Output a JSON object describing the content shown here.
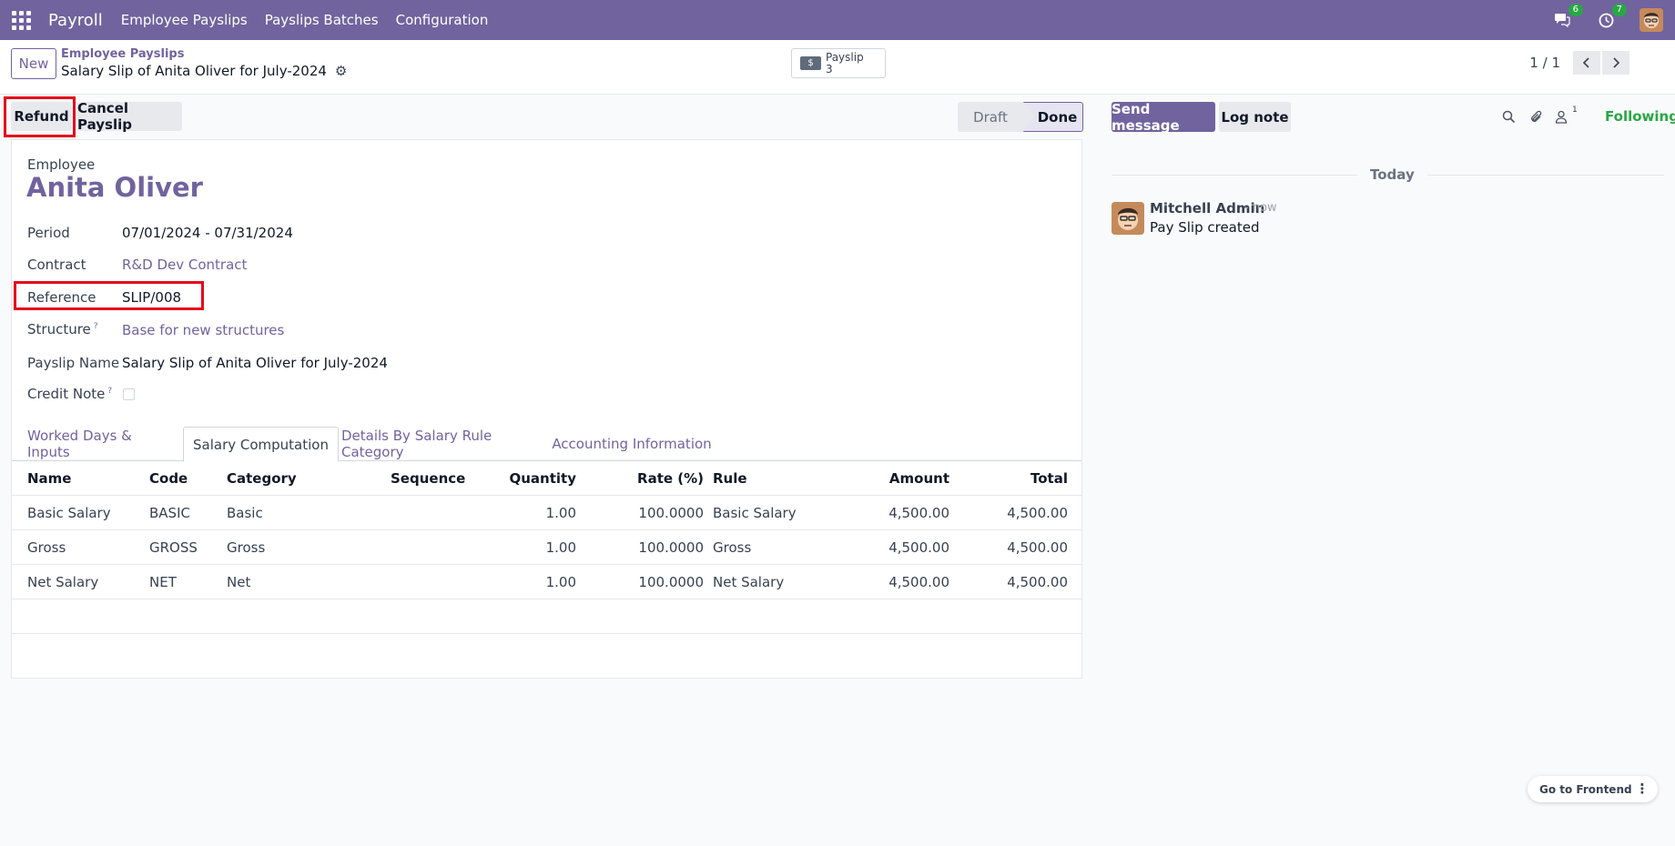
{
  "navbar": {
    "brand": "Payroll",
    "items": [
      "Employee Payslips",
      "Payslips Batches",
      "Configuration"
    ],
    "messages_badge": "6",
    "activities_badge": "7"
  },
  "control": {
    "new_label": "New",
    "breadcrumb_parent": "Employee Payslips",
    "breadcrumb_current": "Salary Slip of Anita Oliver for July-2024",
    "smart_button": {
      "label": "Payslip",
      "count": "3"
    },
    "pager": "1 / 1"
  },
  "actions": {
    "refund": "Refund",
    "cancel": "Cancel Payslip"
  },
  "status": {
    "draft": "Draft",
    "done": "Done"
  },
  "form": {
    "employee_label": "Employee",
    "employee_name": "Anita Oliver",
    "fields": {
      "period_label": "Period",
      "period_value": "07/01/2024 - 07/31/2024",
      "contract_label": "Contract",
      "contract_value": "R&D Dev Contract",
      "reference_label": "Reference",
      "reference_value": "SLIP/008",
      "structure_label": "Structure",
      "structure_value": "Base for new structures",
      "payslip_name_label": "Payslip Name",
      "payslip_name_value": "Salary Slip of Anita Oliver for July-2024",
      "credit_note_label": "Credit Note"
    },
    "help_mark": "?",
    "tabs": [
      "Worked Days & Inputs",
      "Salary Computation",
      "Details By Salary Rule Category",
      "Accounting Information"
    ],
    "active_tab": "Salary Computation"
  },
  "table": {
    "headers": [
      "Name",
      "Code",
      "Category",
      "Sequence",
      "Quantity",
      "Rate (%)",
      "Rule",
      "Amount",
      "Total"
    ],
    "rows": [
      [
        "Basic Salary",
        "BASIC",
        "Basic",
        "",
        "1.00",
        "100.0000",
        "Basic Salary",
        "4,500.00",
        "4,500.00"
      ],
      [
        "Gross",
        "GROSS",
        "Gross",
        "",
        "1.00",
        "100.0000",
        "Gross",
        "4,500.00",
        "4,500.00"
      ],
      [
        "Net Salary",
        "NET",
        "Net",
        "",
        "1.00",
        "100.0000",
        "Net Salary",
        "4,500.00",
        "4,500.00"
      ]
    ]
  },
  "chatter": {
    "send_message": "Send message",
    "log_note": "Log note",
    "followers_count": "1",
    "following": "Following",
    "date_separator": "Today",
    "message": {
      "author": "Mitchell Admin",
      "time": "- now",
      "body": "Pay Slip created"
    }
  },
  "frontend": {
    "label": "Go to Frontend"
  },
  "colors": {
    "brand": "#71639e",
    "highlight": "#e5091b",
    "following": "#28a745"
  }
}
